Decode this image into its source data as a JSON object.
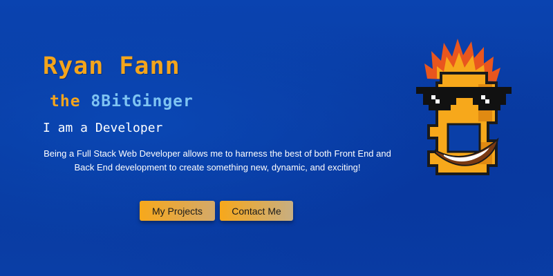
{
  "hero": {
    "name": "Ryan Fann",
    "tagline_word1": "the",
    "tagline_word2": "8BitGinger",
    "role": "I am a Developer",
    "bio": "Being a Full Stack Web Developer allows me to harness the best of both Front End and Back End development to create something new, dynamic, and exciting!"
  },
  "buttons": {
    "projects_label": "My Projects",
    "contact_label": "Contact Me"
  },
  "logo": {
    "icon": "8bit-ginger-mascot-icon"
  },
  "colors": {
    "background": "#0a3fa8",
    "accent_orange": "#f4a51c",
    "accent_blue": "#7fc4f2"
  }
}
